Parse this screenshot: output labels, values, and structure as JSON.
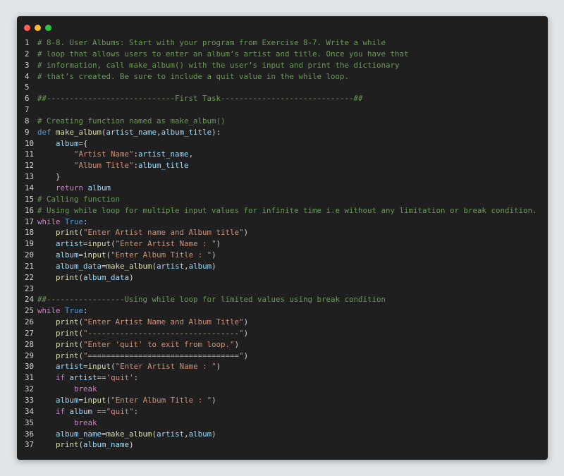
{
  "window": {
    "buttons": [
      "close",
      "minimize",
      "maximize"
    ],
    "colors": {
      "background": "#1f1f1f",
      "close": "#ff5f57",
      "minimize": "#febc2e",
      "maximize": "#28c840"
    }
  },
  "editor": {
    "language": "python",
    "lines": [
      {
        "number": "1",
        "tokens": [
          {
            "t": "com",
            "v": "# 8-8. User Albums: Start with your program from Exercise 8-7. Write a while"
          }
        ]
      },
      {
        "number": "2",
        "tokens": [
          {
            "t": "com",
            "v": "# loop that allows users to enter an album’s artist and title. Once you have that"
          }
        ]
      },
      {
        "number": "3",
        "tokens": [
          {
            "t": "com",
            "v": "# information, call make_album() with the user’s input and print the dictionary"
          }
        ]
      },
      {
        "number": "4",
        "tokens": [
          {
            "t": "com",
            "v": "# that’s created. Be sure to include a quit value in the while loop."
          }
        ]
      },
      {
        "number": "5",
        "tokens": []
      },
      {
        "number": "6",
        "tokens": [
          {
            "t": "com",
            "v": "##----------------------------First Task-----------------------------##"
          }
        ]
      },
      {
        "number": "7",
        "tokens": []
      },
      {
        "number": "8",
        "tokens": [
          {
            "t": "com",
            "v": "# Creating function named as make_album()"
          }
        ]
      },
      {
        "number": "9",
        "tokens": [
          {
            "t": "kw",
            "v": "def "
          },
          {
            "t": "fn",
            "v": "make_album"
          },
          {
            "t": "pun",
            "v": "("
          },
          {
            "t": "var",
            "v": "artist_name"
          },
          {
            "t": "pun",
            "v": ","
          },
          {
            "t": "var",
            "v": "album_title"
          },
          {
            "t": "pun",
            "v": "):"
          }
        ]
      },
      {
        "number": "10",
        "tokens": [
          {
            "t": "txt",
            "v": "    "
          },
          {
            "t": "var",
            "v": "album"
          },
          {
            "t": "pun",
            "v": "={"
          }
        ]
      },
      {
        "number": "11",
        "tokens": [
          {
            "t": "txt",
            "v": "        "
          },
          {
            "t": "str",
            "v": "\"Artist Name\""
          },
          {
            "t": "pun",
            "v": ":"
          },
          {
            "t": "var",
            "v": "artist_name"
          },
          {
            "t": "pun",
            "v": ","
          }
        ]
      },
      {
        "number": "12",
        "tokens": [
          {
            "t": "txt",
            "v": "        "
          },
          {
            "t": "str",
            "v": "\"Album Title\""
          },
          {
            "t": "pun",
            "v": ":"
          },
          {
            "t": "var",
            "v": "album_title"
          }
        ]
      },
      {
        "number": "13",
        "tokens": [
          {
            "t": "txt",
            "v": "    "
          },
          {
            "t": "pun",
            "v": "}"
          }
        ]
      },
      {
        "number": "14",
        "tokens": [
          {
            "t": "txt",
            "v": "    "
          },
          {
            "t": "ctl",
            "v": "return "
          },
          {
            "t": "var",
            "v": "album"
          }
        ]
      },
      {
        "number": "15",
        "tokens": [
          {
            "t": "com",
            "v": "# Calling function"
          }
        ]
      },
      {
        "number": "16",
        "tokens": [
          {
            "t": "com",
            "v": "# Using while loop for multiple input values for infinite time i.e without any limitation or break condition."
          }
        ]
      },
      {
        "number": "17",
        "tokens": [
          {
            "t": "ctl",
            "v": "while "
          },
          {
            "t": "kw",
            "v": "True"
          },
          {
            "t": "pun",
            "v": ":"
          }
        ]
      },
      {
        "number": "18",
        "tokens": [
          {
            "t": "txt",
            "v": "    "
          },
          {
            "t": "fn",
            "v": "print"
          },
          {
            "t": "pun",
            "v": "("
          },
          {
            "t": "str",
            "v": "\"Enter Artist name and Album title\""
          },
          {
            "t": "pun",
            "v": ")"
          }
        ]
      },
      {
        "number": "19",
        "tokens": [
          {
            "t": "txt",
            "v": "    "
          },
          {
            "t": "var",
            "v": "artist"
          },
          {
            "t": "pun",
            "v": "="
          },
          {
            "t": "fn",
            "v": "input"
          },
          {
            "t": "pun",
            "v": "("
          },
          {
            "t": "str",
            "v": "\"Enter Artist Name : \""
          },
          {
            "t": "pun",
            "v": ")"
          }
        ]
      },
      {
        "number": "20",
        "tokens": [
          {
            "t": "txt",
            "v": "    "
          },
          {
            "t": "var",
            "v": "album"
          },
          {
            "t": "pun",
            "v": "="
          },
          {
            "t": "fn",
            "v": "input"
          },
          {
            "t": "pun",
            "v": "("
          },
          {
            "t": "str",
            "v": "\"Enter Album Title : \""
          },
          {
            "t": "pun",
            "v": ")"
          }
        ]
      },
      {
        "number": "21",
        "tokens": [
          {
            "t": "txt",
            "v": "    "
          },
          {
            "t": "var",
            "v": "album_data"
          },
          {
            "t": "pun",
            "v": "="
          },
          {
            "t": "fn",
            "v": "make_album"
          },
          {
            "t": "pun",
            "v": "("
          },
          {
            "t": "var",
            "v": "artist"
          },
          {
            "t": "pun",
            "v": ","
          },
          {
            "t": "var",
            "v": "album"
          },
          {
            "t": "pun",
            "v": ")"
          }
        ]
      },
      {
        "number": "22",
        "tokens": [
          {
            "t": "txt",
            "v": "    "
          },
          {
            "t": "fn",
            "v": "print"
          },
          {
            "t": "pun",
            "v": "("
          },
          {
            "t": "var",
            "v": "album_data"
          },
          {
            "t": "pun",
            "v": ")"
          }
        ]
      },
      {
        "number": "23",
        "tokens": []
      },
      {
        "number": "24",
        "tokens": [
          {
            "t": "com",
            "v": "##-----------------Using while loop for limited values using break condition"
          }
        ]
      },
      {
        "number": "25",
        "tokens": [
          {
            "t": "ctl",
            "v": "while "
          },
          {
            "t": "kw",
            "v": "True"
          },
          {
            "t": "pun",
            "v": ":"
          }
        ]
      },
      {
        "number": "26",
        "tokens": [
          {
            "t": "txt",
            "v": "    "
          },
          {
            "t": "fn",
            "v": "print"
          },
          {
            "t": "pun",
            "v": "("
          },
          {
            "t": "str",
            "v": "\"Enter Artist Name and Album Title\""
          },
          {
            "t": "pun",
            "v": ")"
          }
        ]
      },
      {
        "number": "27",
        "tokens": [
          {
            "t": "txt",
            "v": "    "
          },
          {
            "t": "fn",
            "v": "print"
          },
          {
            "t": "pun",
            "v": "("
          },
          {
            "t": "str",
            "v": "\"---------------------------------\""
          },
          {
            "t": "pun",
            "v": ")"
          }
        ]
      },
      {
        "number": "28",
        "tokens": [
          {
            "t": "txt",
            "v": "    "
          },
          {
            "t": "fn",
            "v": "print"
          },
          {
            "t": "pun",
            "v": "("
          },
          {
            "t": "str",
            "v": "\"Enter 'quit' to exit from loop.\""
          },
          {
            "t": "pun",
            "v": ")"
          }
        ]
      },
      {
        "number": "29",
        "tokens": [
          {
            "t": "txt",
            "v": "    "
          },
          {
            "t": "fn",
            "v": "print"
          },
          {
            "t": "pun",
            "v": "("
          },
          {
            "t": "str",
            "v": "\"=================================\""
          },
          {
            "t": "pun",
            "v": ")"
          }
        ]
      },
      {
        "number": "30",
        "tokens": [
          {
            "t": "txt",
            "v": "    "
          },
          {
            "t": "var",
            "v": "artist"
          },
          {
            "t": "pun",
            "v": "="
          },
          {
            "t": "fn",
            "v": "input"
          },
          {
            "t": "pun",
            "v": "("
          },
          {
            "t": "str",
            "v": "\"Enter Artist Name : \""
          },
          {
            "t": "pun",
            "v": ")"
          }
        ]
      },
      {
        "number": "31",
        "tokens": [
          {
            "t": "txt",
            "v": "    "
          },
          {
            "t": "ctl",
            "v": "if "
          },
          {
            "t": "var",
            "v": "artist"
          },
          {
            "t": "pun",
            "v": "=="
          },
          {
            "t": "str",
            "v": "'quit'"
          },
          {
            "t": "pun",
            "v": ":"
          }
        ]
      },
      {
        "number": "32",
        "tokens": [
          {
            "t": "txt",
            "v": "        "
          },
          {
            "t": "ctl",
            "v": "break"
          }
        ]
      },
      {
        "number": "33",
        "tokens": [
          {
            "t": "txt",
            "v": "    "
          },
          {
            "t": "var",
            "v": "album"
          },
          {
            "t": "pun",
            "v": "="
          },
          {
            "t": "fn",
            "v": "input"
          },
          {
            "t": "pun",
            "v": "("
          },
          {
            "t": "str",
            "v": "\"Enter Album Title : \""
          },
          {
            "t": "pun",
            "v": ")"
          }
        ]
      },
      {
        "number": "34",
        "tokens": [
          {
            "t": "txt",
            "v": "    "
          },
          {
            "t": "ctl",
            "v": "if "
          },
          {
            "t": "var",
            "v": "album "
          },
          {
            "t": "pun",
            "v": "=="
          },
          {
            "t": "str",
            "v": "\"quit\""
          },
          {
            "t": "pun",
            "v": ":"
          }
        ]
      },
      {
        "number": "35",
        "tokens": [
          {
            "t": "txt",
            "v": "        "
          },
          {
            "t": "ctl",
            "v": "break"
          }
        ]
      },
      {
        "number": "36",
        "tokens": [
          {
            "t": "txt",
            "v": "    "
          },
          {
            "t": "var",
            "v": "album_name"
          },
          {
            "t": "pun",
            "v": "="
          },
          {
            "t": "fn",
            "v": "make_album"
          },
          {
            "t": "pun",
            "v": "("
          },
          {
            "t": "var",
            "v": "artist"
          },
          {
            "t": "pun",
            "v": ","
          },
          {
            "t": "var",
            "v": "album"
          },
          {
            "t": "pun",
            "v": ")"
          }
        ]
      },
      {
        "number": "37",
        "tokens": [
          {
            "t": "txt",
            "v": "    "
          },
          {
            "t": "fn",
            "v": "print"
          },
          {
            "t": "pun",
            "v": "("
          },
          {
            "t": "var",
            "v": "album_name"
          },
          {
            "t": "pun",
            "v": ")"
          }
        ]
      }
    ]
  }
}
